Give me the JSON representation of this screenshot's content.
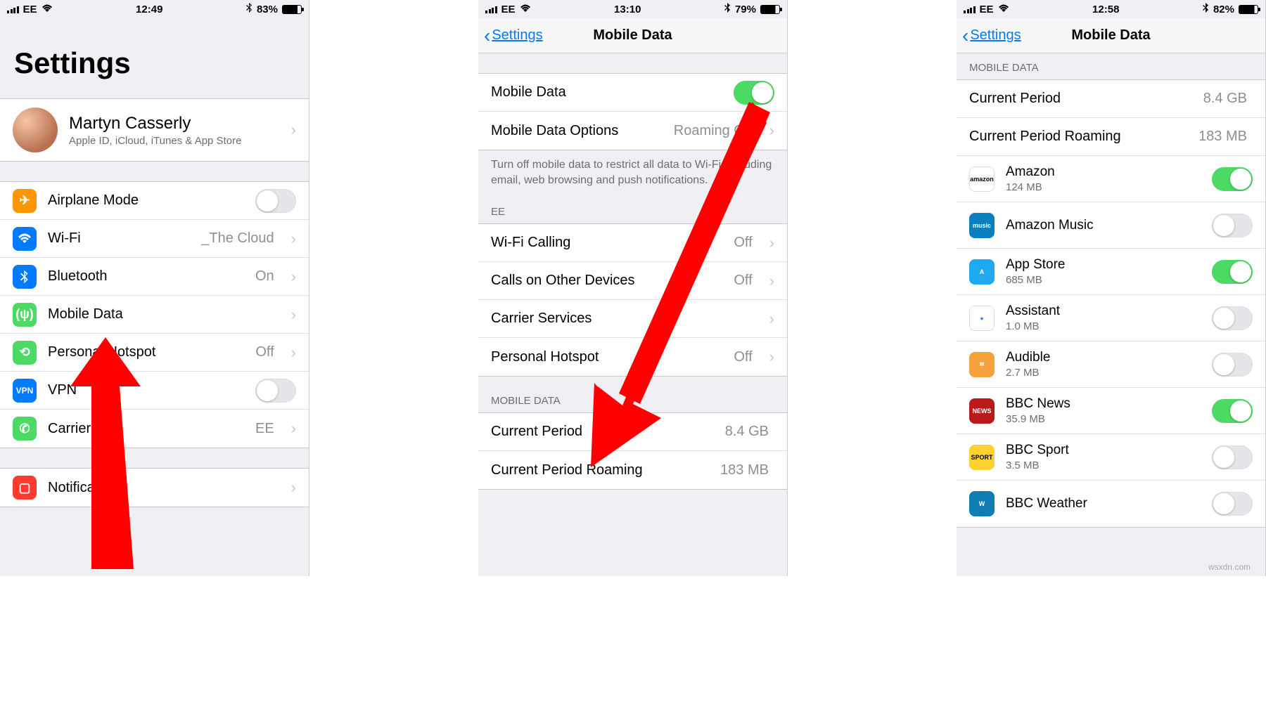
{
  "colors": {
    "green": "#4cd964",
    "orange": "#ff9500",
    "blue": "#007aff",
    "teal": "#34c759"
  },
  "screen1": {
    "status": {
      "carrier": "EE",
      "time": "12:49",
      "battery": "83%"
    },
    "title": "Settings",
    "profile": {
      "name": "Martyn Casserly",
      "sub": "Apple ID, iCloud, iTunes & App Store"
    },
    "rows": {
      "airplane": "Airplane Mode",
      "wifi_label": "Wi-Fi",
      "wifi_value": "_The Cloud",
      "bluetooth_label": "Bluetooth",
      "bluetooth_value": "On",
      "mobile_data": "Mobile Data",
      "hotspot_label": "Personal Hotspot",
      "hotspot_value": "Off",
      "vpn": "VPN",
      "carrier_label": "Carrier",
      "carrier_value": "EE",
      "notifications": "Notifications"
    }
  },
  "screen2": {
    "status": {
      "carrier": "EE",
      "time": "13:10",
      "battery": "79%"
    },
    "nav_back": "Settings",
    "nav_title": "Mobile Data",
    "rows": {
      "mobile_data": "Mobile Data",
      "options_label": "Mobile Data Options",
      "options_value": "Roaming Off",
      "footer": "Turn off mobile data to restrict all data to Wi-Fi, including email, web browsing and push notifications.",
      "section_ee": "EE",
      "wifi_calling_label": "Wi-Fi Calling",
      "wifi_calling_value": "Off",
      "calls_label": "Calls on Other Devices",
      "calls_value": "Off",
      "carrier_services": "Carrier Services",
      "hotspot_label": "Personal Hotspot",
      "hotspot_value": "Off",
      "section_md": "MOBILE DATA",
      "period_label": "Current Period",
      "period_value": "8.4 GB",
      "roaming_label": "Current Period Roaming",
      "roaming_value": "183 MB"
    }
  },
  "screen3": {
    "status": {
      "carrier": "EE",
      "time": "12:58",
      "battery": "82%"
    },
    "nav_back": "Settings",
    "nav_title": "Mobile Data",
    "section_md": "MOBILE DATA",
    "period_label": "Current Period",
    "period_value": "8.4 GB",
    "roaming_label": "Current Period Roaming",
    "roaming_value": "183 MB",
    "apps": [
      {
        "name": "Amazon",
        "usage": "124 MB",
        "on": true,
        "color": "#fff",
        "label": "amazon",
        "labelColor": "#000"
      },
      {
        "name": "Amazon Music",
        "usage": "",
        "on": false,
        "color": "#0a7fbf",
        "label": "music"
      },
      {
        "name": "App Store",
        "usage": "685 MB",
        "on": true,
        "color": "#1fa9f2",
        "label": "A"
      },
      {
        "name": "Assistant",
        "usage": "1.0 MB",
        "on": false,
        "color": "#fff",
        "label": "●",
        "labelColor": "#4285f4"
      },
      {
        "name": "Audible",
        "usage": "2.7 MB",
        "on": false,
        "color": "#f7a13c",
        "label": "≋"
      },
      {
        "name": "BBC News",
        "usage": "35.9 MB",
        "on": true,
        "color": "#bb1919",
        "label": "NEWS"
      },
      {
        "name": "BBC Sport",
        "usage": "3.5 MB",
        "on": false,
        "color": "#ffd230",
        "label": "SPORT",
        "labelColor": "#000"
      },
      {
        "name": "BBC Weather",
        "usage": "",
        "on": false,
        "color": "#0f7db1",
        "label": "W"
      }
    ]
  },
  "watermark": "wsxdn.com"
}
